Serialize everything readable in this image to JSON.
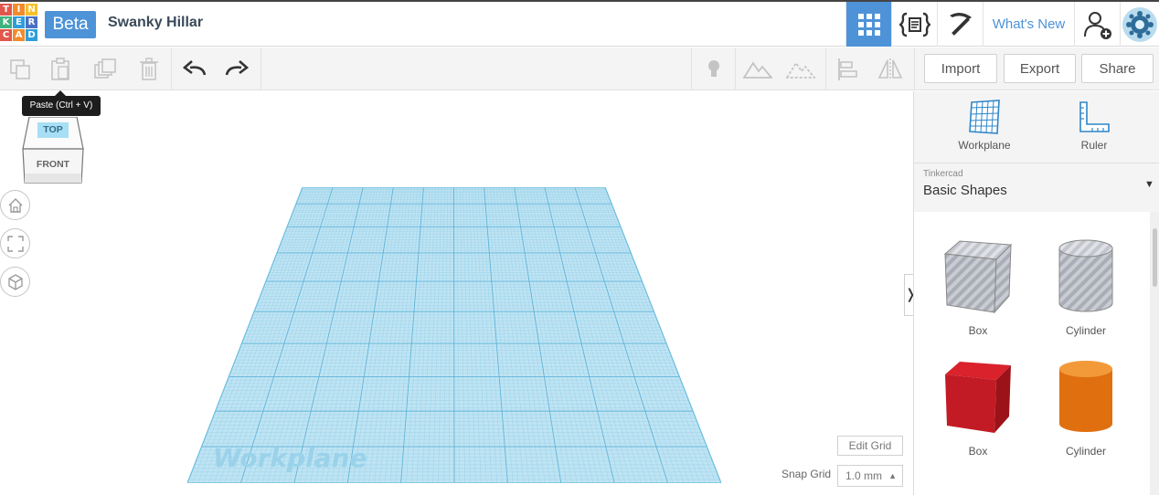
{
  "header": {
    "logo_letters": [
      "T",
      "I",
      "N",
      "K",
      "E",
      "R",
      "C",
      "A",
      "D"
    ],
    "logo_colors": [
      "#e2574c",
      "#f28b2c",
      "#f7c02c",
      "#3fb27f",
      "#2e9ed9",
      "#4a70c2",
      "#e2574c",
      "#f28b2c",
      "#2e9ed9"
    ],
    "beta_label": "Beta",
    "project_name": "Swanky Hillar",
    "whats_new": "What's New"
  },
  "toolbar": {
    "import_label": "Import",
    "export_label": "Export",
    "share_label": "Share"
  },
  "tooltip": {
    "text": "Paste (Ctrl + V)"
  },
  "viewcube": {
    "top": "TOP",
    "front": "FRONT"
  },
  "workplane": {
    "watermark": "Workplane",
    "edit_grid": "Edit Grid",
    "snap_label": "Snap Grid",
    "snap_value": "1.0 mm"
  },
  "panel": {
    "workplane_label": "Workplane",
    "ruler_label": "Ruler",
    "category_small": "Tinkercad",
    "category": "Basic Shapes",
    "shapes": [
      "Box",
      "Cylinder",
      "Box",
      "Cylinder"
    ]
  },
  "colors": {
    "accent": "#4e93d8",
    "grid": "#a8d8ec",
    "box_red": "#cc1e28",
    "cyl_orange": "#e67412"
  }
}
